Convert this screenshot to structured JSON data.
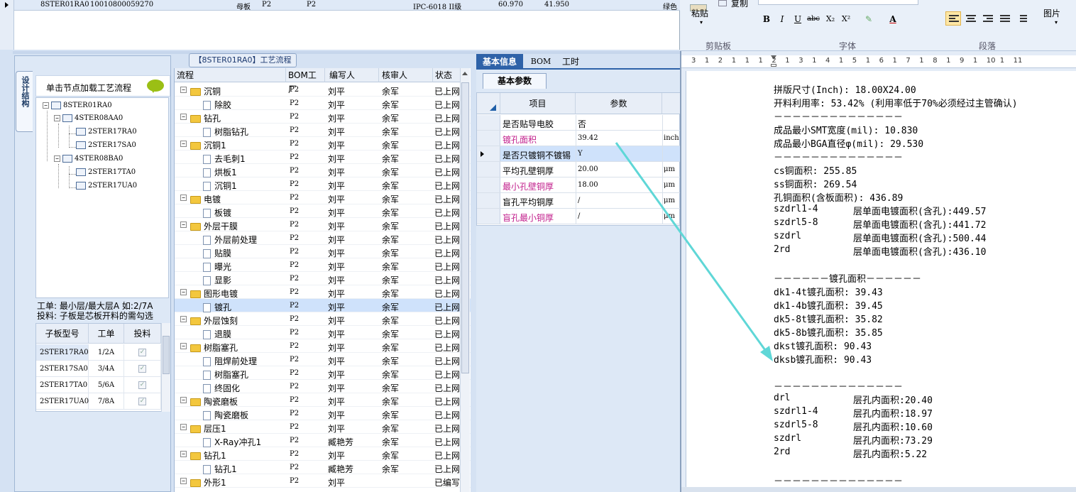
{
  "top_grid": {
    "row": [
      "8STER01RA0",
      "10010800059270",
      "母板",
      "P2",
      "P2",
      "IPC-6018 II级",
      "60.970",
      "41.950",
      "绿色"
    ]
  },
  "left_panel": {
    "vertical_tab": "设计结构",
    "load_hint": "单击节点加载工艺流程",
    "tree": [
      {
        "label": "8STER01RA0",
        "level": 0
      },
      {
        "label": "4STER08AA0",
        "level": 1
      },
      {
        "label": "2STER17RA0",
        "level": 2
      },
      {
        "label": "2STER17SA0",
        "level": 2
      },
      {
        "label": "4STER08BA0",
        "level": 1
      },
      {
        "label": "2STER17TA0",
        "level": 2
      },
      {
        "label": "2STER17UA0",
        "level": 2
      }
    ],
    "info_line1": "工单: 最小层/最大层A 如:2/7A",
    "info_line2": "投料: 子板是芯板开料的需勾选",
    "sub_grid": {
      "headers": [
        "子板型号",
        "工单",
        "投料"
      ],
      "rows": [
        {
          "model": "2STER17RA0",
          "order": "1/2A"
        },
        {
          "model": "2STER17SA0",
          "order": "3/4A"
        },
        {
          "model": "2STER17TA0",
          "order": "5/6A"
        },
        {
          "model": "2STER17UA0",
          "order": "7/8A"
        }
      ]
    }
  },
  "flow": {
    "title": "【8STER01RA0】工艺流程",
    "headers": [
      "流程",
      "BOM工厂",
      "编写人",
      "核审人",
      "状态"
    ],
    "rows": [
      {
        "name": "沉铜",
        "type": "folder",
        "bom": "P2",
        "writer": "刘平",
        "checker": "余军",
        "status": "已上网"
      },
      {
        "name": "除胶",
        "type": "leaf",
        "bom": "P2",
        "writer": "刘平",
        "checker": "余军",
        "status": "已上网"
      },
      {
        "name": "钻孔",
        "type": "folder",
        "bom": "P2",
        "writer": "刘平",
        "checker": "余军",
        "status": "已上网"
      },
      {
        "name": "树脂钻孔",
        "type": "leaf",
        "bom": "P2",
        "writer": "刘平",
        "checker": "余军",
        "status": "已上网"
      },
      {
        "name": "沉铜1",
        "type": "folder",
        "bom": "P2",
        "writer": "刘平",
        "checker": "余军",
        "status": "已上网"
      },
      {
        "name": "去毛刺1",
        "type": "leaf",
        "bom": "P2",
        "writer": "刘平",
        "checker": "余军",
        "status": "已上网"
      },
      {
        "name": "烘板1",
        "type": "leaf",
        "bom": "P2",
        "writer": "刘平",
        "checker": "余军",
        "status": "已上网"
      },
      {
        "name": "沉铜1",
        "type": "leaf",
        "bom": "P2",
        "writer": "刘平",
        "checker": "余军",
        "status": "已上网"
      },
      {
        "name": "电镀",
        "type": "folder",
        "bom": "P2",
        "writer": "刘平",
        "checker": "余军",
        "status": "已上网"
      },
      {
        "name": "板镀",
        "type": "leaf",
        "bom": "P2",
        "writer": "刘平",
        "checker": "余军",
        "status": "已上网"
      },
      {
        "name": "外层干膜",
        "type": "folder",
        "bom": "P2",
        "writer": "刘平",
        "checker": "余军",
        "status": "已上网"
      },
      {
        "name": "外层前处理",
        "type": "leaf",
        "bom": "P2",
        "writer": "刘平",
        "checker": "余军",
        "status": "已上网"
      },
      {
        "name": "贴膜",
        "type": "leaf",
        "bom": "P2",
        "writer": "刘平",
        "checker": "余军",
        "status": "已上网"
      },
      {
        "name": "曝光",
        "type": "leaf",
        "bom": "P2",
        "writer": "刘平",
        "checker": "余军",
        "status": "已上网"
      },
      {
        "name": "显影",
        "type": "leaf",
        "bom": "P2",
        "writer": "刘平",
        "checker": "余军",
        "status": "已上网"
      },
      {
        "name": "图形电镀",
        "type": "folder",
        "bom": "P2",
        "writer": "刘平",
        "checker": "余军",
        "status": "已上网"
      },
      {
        "name": "镀孔",
        "type": "leaf",
        "bom": "P2",
        "writer": "刘平",
        "checker": "余军",
        "status": "已上网",
        "selected": true
      },
      {
        "name": "外层蚀刻",
        "type": "folder",
        "bom": "P2",
        "writer": "刘平",
        "checker": "余军",
        "status": "已上网"
      },
      {
        "name": "退膜",
        "type": "leaf",
        "bom": "P2",
        "writer": "刘平",
        "checker": "余军",
        "status": "已上网"
      },
      {
        "name": "树脂塞孔",
        "type": "folder",
        "bom": "P2",
        "writer": "刘平",
        "checker": "余军",
        "status": "已上网"
      },
      {
        "name": "阻焊前处理",
        "type": "leaf",
        "bom": "P2",
        "writer": "刘平",
        "checker": "余军",
        "status": "已上网"
      },
      {
        "name": "树脂塞孔",
        "type": "leaf",
        "bom": "P2",
        "writer": "刘平",
        "checker": "余军",
        "status": "已上网"
      },
      {
        "name": "终固化",
        "type": "leaf",
        "bom": "P2",
        "writer": "刘平",
        "checker": "余军",
        "status": "已上网"
      },
      {
        "name": "陶瓷磨板",
        "type": "folder",
        "bom": "P2",
        "writer": "刘平",
        "checker": "余军",
        "status": "已上网"
      },
      {
        "name": "陶瓷磨板",
        "type": "leaf",
        "bom": "P2",
        "writer": "刘平",
        "checker": "余军",
        "status": "已上网"
      },
      {
        "name": "层压1",
        "type": "folder",
        "bom": "P2",
        "writer": "刘平",
        "checker": "余军",
        "status": "已上网"
      },
      {
        "name": "X-Ray冲孔1",
        "type": "leaf",
        "bom": "P2",
        "writer": "臧艳芳",
        "checker": "余军",
        "status": "已上网"
      },
      {
        "name": "钻孔1",
        "type": "folder",
        "bom": "P2",
        "writer": "刘平",
        "checker": "余军",
        "status": "已上网"
      },
      {
        "name": "钻孔1",
        "type": "leaf",
        "bom": "P2",
        "writer": "臧艳芳",
        "checker": "余军",
        "status": "已上网"
      },
      {
        "name": "外形1",
        "type": "folder",
        "bom": "P2",
        "writer": "刘平",
        "checker": "",
        "status": "已编写"
      }
    ]
  },
  "info_panel": {
    "tabs": [
      "基本信息",
      "BOM",
      "工时"
    ],
    "sub_tab": "基本参数",
    "headers": [
      "项目",
      "参数"
    ],
    "rows": [
      {
        "item": "是否贴导电胶",
        "value": "否",
        "unit": "",
        "highlight": false
      },
      {
        "item": "镀孔面积",
        "value": "39.42",
        "unit": "inch",
        "highlight": true
      },
      {
        "item": "是否只镀铜不镀锡",
        "value": "Y",
        "unit": "",
        "highlight": false,
        "current": true
      },
      {
        "item": "平均孔壁铜厚",
        "value": "20.00",
        "unit": "μm",
        "highlight": false
      },
      {
        "item": "最小孔壁铜厚",
        "value": "18.00",
        "unit": "μm",
        "highlight": true
      },
      {
        "item": "盲孔平均铜厚",
        "value": "/",
        "unit": "μm",
        "highlight": false
      },
      {
        "item": "盲孔最小铜厚",
        "value": "/",
        "unit": "μm",
        "highlight": true
      }
    ]
  },
  "word": {
    "ribbon": {
      "paste": "粘贴",
      "copy": "复制",
      "clipboard": "剪贴板",
      "font": "字体",
      "paragraph": "段落",
      "picture": "图片"
    },
    "ruler": [
      "3",
      "1",
      "2",
      "1",
      "1",
      "1",
      "2",
      "1",
      "3",
      "1",
      "4",
      "1",
      "5",
      "1",
      "6",
      "1",
      "7",
      "1",
      "8",
      "1",
      "9",
      "1",
      "10",
      "1",
      "11"
    ],
    "lines": [
      {
        "a": "拼版尺寸(Inch): 18.00X24.00",
        "b": ""
      },
      {
        "a": "开料利用率: 53.42% (利用率低于70%必须经过主管确认)",
        "b": ""
      },
      {
        "a": "－－－－－－－－－－－－－－",
        "b": ""
      },
      {
        "a": "成品最小SMT宽度(mil): 10.830",
        "b": ""
      },
      {
        "a": "成品最小BGA直径φ(mil): 29.530",
        "b": ""
      },
      {
        "a": "－－－－－－－－－－－－－－",
        "b": ""
      },
      {
        "a": "cs铜面积: 255.85",
        "b": ""
      },
      {
        "a": "ss铜面积: 269.54",
        "b": ""
      },
      {
        "a": "孔铜面积(含板面积): 436.89",
        "b": ""
      },
      {
        "a": "szdrl1-4",
        "b": "层单面电镀面积(含孔):449.57"
      },
      {
        "a": "szdrl5-8",
        "b": "层单面电镀面积(含孔):441.72"
      },
      {
        "a": "szdrl",
        "b": "层单面电镀面积(含孔):500.44"
      },
      {
        "a": "2rd",
        "b": "层单面电镀面积(含孔):436.10"
      },
      {
        "a": "",
        "b": ""
      },
      {
        "a": "－－－－－－镀孔面积－－－－－－",
        "b": ""
      },
      {
        "a": "dk1-4t镀孔面积: 39.43",
        "b": ""
      },
      {
        "a": "dk1-4b镀孔面积: 39.45",
        "b": ""
      },
      {
        "a": "dk5-8t镀孔面积: 35.82",
        "b": ""
      },
      {
        "a": "dk5-8b镀孔面积: 35.85",
        "b": ""
      },
      {
        "a": "dkst镀孔面积: 90.43",
        "b": ""
      },
      {
        "a": "dksb镀孔面积: 90.43",
        "b": ""
      },
      {
        "a": "",
        "b": ""
      },
      {
        "a": "－－－－－－－－－－－－－－",
        "b": ""
      },
      {
        "a": "drl",
        "b": "层孔内面积:20.40"
      },
      {
        "a": "szdrl1-4",
        "b": "层孔内面积:18.97"
      },
      {
        "a": "szdrl5-8",
        "b": "层孔内面积:10.60"
      },
      {
        "a": "szdrl",
        "b": "层孔内面积:73.29"
      },
      {
        "a": "2rd",
        "b": "层孔内面积:5.22"
      },
      {
        "a": "",
        "b": ""
      },
      {
        "a": "－－－－－－－－－－－－－－",
        "b": ""
      }
    ]
  },
  "colors": {
    "accent": "#2e62a8",
    "magenta_text": "#c2208c",
    "arrow": "#5fd7d7",
    "selected_row": "#cfe2fb"
  }
}
